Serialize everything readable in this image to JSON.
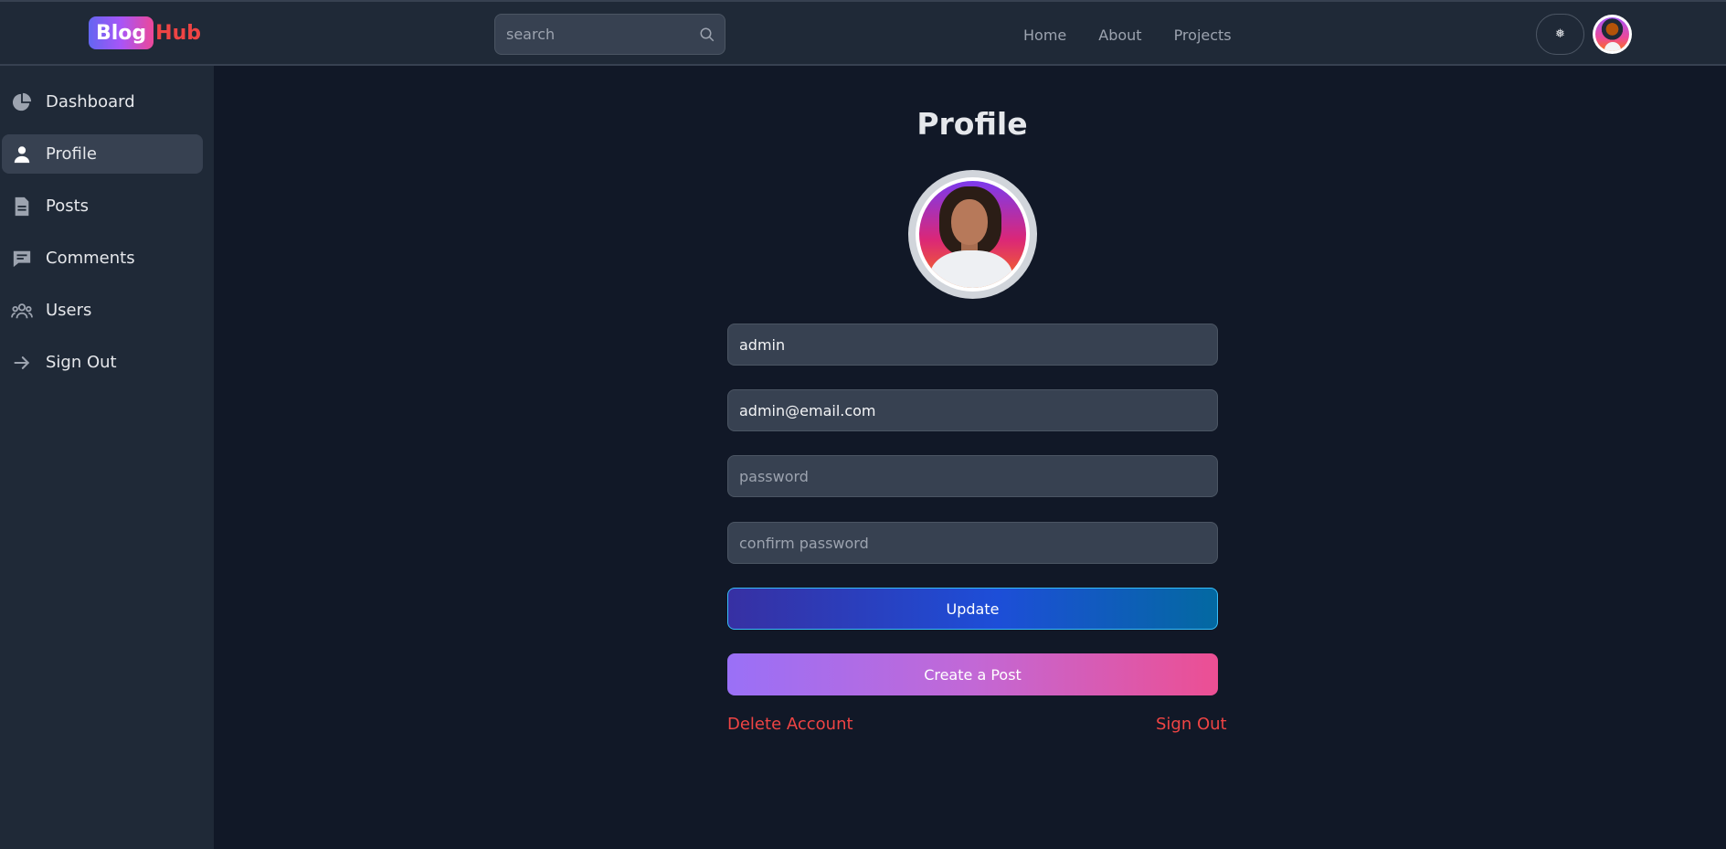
{
  "header": {
    "logo_badge": "Blog",
    "logo_rest": "Hub",
    "search_placeholder": "search",
    "nav": [
      "Home",
      "About",
      "Projects"
    ],
    "theme_icon": "❅"
  },
  "sidebar": {
    "items": [
      {
        "label": "Dashboard",
        "icon": "pie-chart-icon",
        "active": false
      },
      {
        "label": "Profile",
        "icon": "user-icon",
        "active": true
      },
      {
        "label": "Posts",
        "icon": "document-icon",
        "active": false
      },
      {
        "label": "Comments",
        "icon": "comment-icon",
        "active": false
      },
      {
        "label": "Users",
        "icon": "users-icon",
        "active": false
      },
      {
        "label": "Sign Out",
        "icon": "arrow-right-icon",
        "active": false
      }
    ]
  },
  "main": {
    "title": "Profile",
    "username_value": "admin",
    "email_value": "admin@email.com",
    "password_placeholder": "password",
    "confirm_placeholder": "confirm password",
    "update_label": "Update",
    "create_post_label": "Create a Post",
    "delete_label": "Delete Account",
    "signout_label": "Sign Out"
  },
  "colors": {
    "background": "#111827",
    "panel": "#1f2937",
    "danger": "#ef4444"
  }
}
